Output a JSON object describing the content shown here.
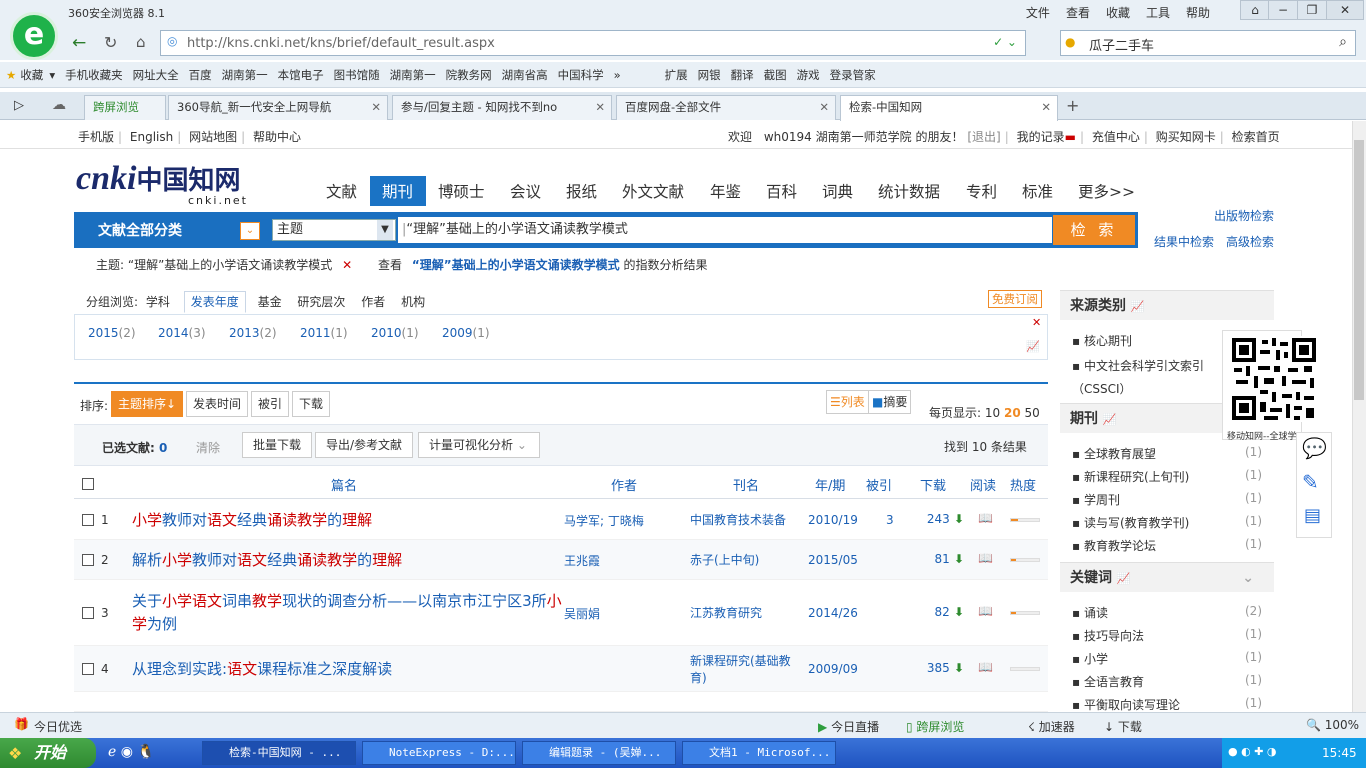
{
  "browser": {
    "app_name": "360安全浏览器 8.1",
    "menu": [
      "文件",
      "查看",
      "收藏",
      "工具",
      "帮助"
    ],
    "url": "http://kns.cnki.net/kns/brief/default_result.aspx",
    "search_text": "瓜子二手车"
  },
  "bookmarks": [
    "收藏",
    "手机收藏夹",
    "网址大全",
    "百度",
    "湖南第一",
    "本馆电子",
    "图书馆随",
    "湖南第一",
    "院教务网",
    "湖南省高",
    "中国科学",
    "扩展",
    "网银",
    "翻译",
    "截图",
    "游戏",
    "登录管家"
  ],
  "tabs": [
    {
      "label": "跨屏浏览"
    },
    {
      "label": "360导航_新一代安全上网导航"
    },
    {
      "label": "参与/回复主题 - 知网找不到no"
    },
    {
      "label": "百度网盘-全部文件"
    },
    {
      "label": "检索-中国知网"
    }
  ],
  "topnav": {
    "links": [
      "手机版",
      "English",
      "网站地图",
      "帮助中心"
    ],
    "welcome": "欢迎",
    "user": "wh0194",
    "org": "湖南第一师范学院",
    "friend": "的朋友！",
    "logout": "[退出]",
    "right": [
      "我的记录",
      "充值中心",
      "购买知网卡",
      "检索首页"
    ]
  },
  "logo": {
    "text": "cnki",
    "cn": "中国知网",
    "domain": "cnki.net"
  },
  "nav": [
    "文献",
    "期刊",
    "博硕士",
    "会议",
    "报纸",
    "外文文献",
    "年鉴",
    "百科",
    "词典",
    "统计数据",
    "专利",
    "标准",
    "更多>>"
  ],
  "search": {
    "all_category": "文献全部分类",
    "field": "主题",
    "query": "“理解”基础上的小学语文诵读教学模式",
    "button": "检 索",
    "right_links": [
      "出版物检索",
      "结果中检索",
      "高级检索"
    ]
  },
  "crumb": {
    "label": "主题:",
    "query": "“理解”基础上的小学语文诵读教学模式",
    "view": "查看",
    "query2": "“理解”基础上的小学语文诵读教学模式",
    "suffix": "的指数分析结果"
  },
  "group": {
    "label": "分组浏览:",
    "items": [
      "学科",
      "发表年度",
      "基金",
      "研究层次",
      "作者",
      "机构"
    ],
    "subscribe": "免费订阅",
    "years": [
      {
        "y": "2015",
        "c": "(2)"
      },
      {
        "y": "2014",
        "c": "(3)"
      },
      {
        "y": "2013",
        "c": "(2)"
      },
      {
        "y": "2011",
        "c": "(1)"
      },
      {
        "y": "2010",
        "c": "(1)"
      },
      {
        "y": "2009",
        "c": "(1)"
      }
    ]
  },
  "sort": {
    "label": "排序:",
    "items": [
      "主题排序",
      "发表时间",
      "被引",
      "下载"
    ],
    "list": "列表",
    "abstract": "摘要",
    "per_page_label": "每页显示:",
    "per_page": [
      "10",
      "20",
      "50"
    ]
  },
  "tools": {
    "selected_label": "已选文献:",
    "selected": "0",
    "clear": "清除",
    "buttons": [
      "批量下载",
      "导出/参考文献",
      "计量可视化分析"
    ],
    "found": "找到 10 条结果"
  },
  "columns": [
    "篇名",
    "作者",
    "刊名",
    "年/期",
    "被引",
    "下载",
    "阅读",
    "热度"
  ],
  "rows": [
    {
      "n": "1",
      "title": [
        [
          "小学",
          "h"
        ],
        [
          "教师对",
          ""
        ],
        [
          "语文",
          "h"
        ],
        [
          "经典",
          ""
        ],
        [
          "诵读教学",
          "h"
        ],
        [
          "的",
          ""
        ],
        [
          "理解",
          "h"
        ]
      ],
      "author": "马学军; 丁晓梅",
      "journal": "中国教育技术装备",
      "issue": "2010/19",
      "cited": "3",
      "dl": "243",
      "heat": 0.25
    },
    {
      "n": "2",
      "title": [
        [
          "解析",
          ""
        ],
        [
          "小学",
          "h"
        ],
        [
          "教师对",
          ""
        ],
        [
          "语文",
          "h"
        ],
        [
          "经典",
          ""
        ],
        [
          "诵读教学",
          "h"
        ],
        [
          "的",
          ""
        ],
        [
          "理解",
          "h"
        ]
      ],
      "author": "王兆霞",
      "journal": "赤子(上中旬)",
      "issue": "2015/05",
      "cited": "",
      "dl": "81",
      "heat": 0.18
    },
    {
      "n": "3",
      "title": [
        [
          "关于",
          ""
        ],
        [
          "小学语文",
          "h"
        ],
        [
          "词串",
          ""
        ],
        [
          "教学",
          "h"
        ],
        [
          "现状的调查分析——以南京市江宁区3所",
          ""
        ],
        [
          "小学",
          "h"
        ],
        [
          "为例",
          ""
        ]
      ],
      "author": "吴丽娟",
      "journal": "江苏教育研究",
      "issue": "2014/26",
      "cited": "",
      "dl": "82",
      "heat": 0.18
    },
    {
      "n": "4",
      "title": [
        [
          "从理念到实践:",
          ""
        ],
        [
          "语文",
          "h"
        ],
        [
          "课程标准之深度解读",
          ""
        ]
      ],
      "author": "",
      "journal": "新课程研究(基础教育)",
      "issue": "2009/09",
      "cited": "",
      "dl": "385",
      "heat": 0.0
    }
  ],
  "side": {
    "source_head": "来源类别",
    "sources": [
      {
        "t": "核心期刊",
        "c": ""
      },
      {
        "t": "中文社会科学引文索引（CSSCI）",
        "c": ""
      }
    ],
    "qr_label": "移动知网--全球学",
    "journal_head": "期刊",
    "journals": [
      {
        "t": "全球教育展望",
        "c": "(1)"
      },
      {
        "t": "新课程研究(上旬刊)",
        "c": "(1)"
      },
      {
        "t": "学周刊",
        "c": "(1)"
      },
      {
        "t": "读与写(教育教学刊)",
        "c": "(1)"
      },
      {
        "t": "教育教学论坛",
        "c": "(1)"
      }
    ],
    "kw_head": "关键词",
    "keywords": [
      {
        "t": "诵读",
        "c": "(2)"
      },
      {
        "t": "技巧导向法",
        "c": "(1)"
      },
      {
        "t": "小学",
        "c": "(1)"
      },
      {
        "t": "全语言教育",
        "c": "(1)"
      },
      {
        "t": "平衡取向读写理论",
        "c": "(1)"
      }
    ]
  },
  "status": {
    "left": "今日优选",
    "items": [
      "今日直播",
      "跨屏浏览",
      "加速器",
      "下载"
    ],
    "zoom": "100%"
  },
  "taskbar": {
    "start": "开始",
    "tasks": [
      "检索-中国知网 - ...",
      "NoteExpress - D:...",
      "编辑题录 - (吴婵...",
      "文档1 - Microsof..."
    ],
    "time": "15:45"
  }
}
